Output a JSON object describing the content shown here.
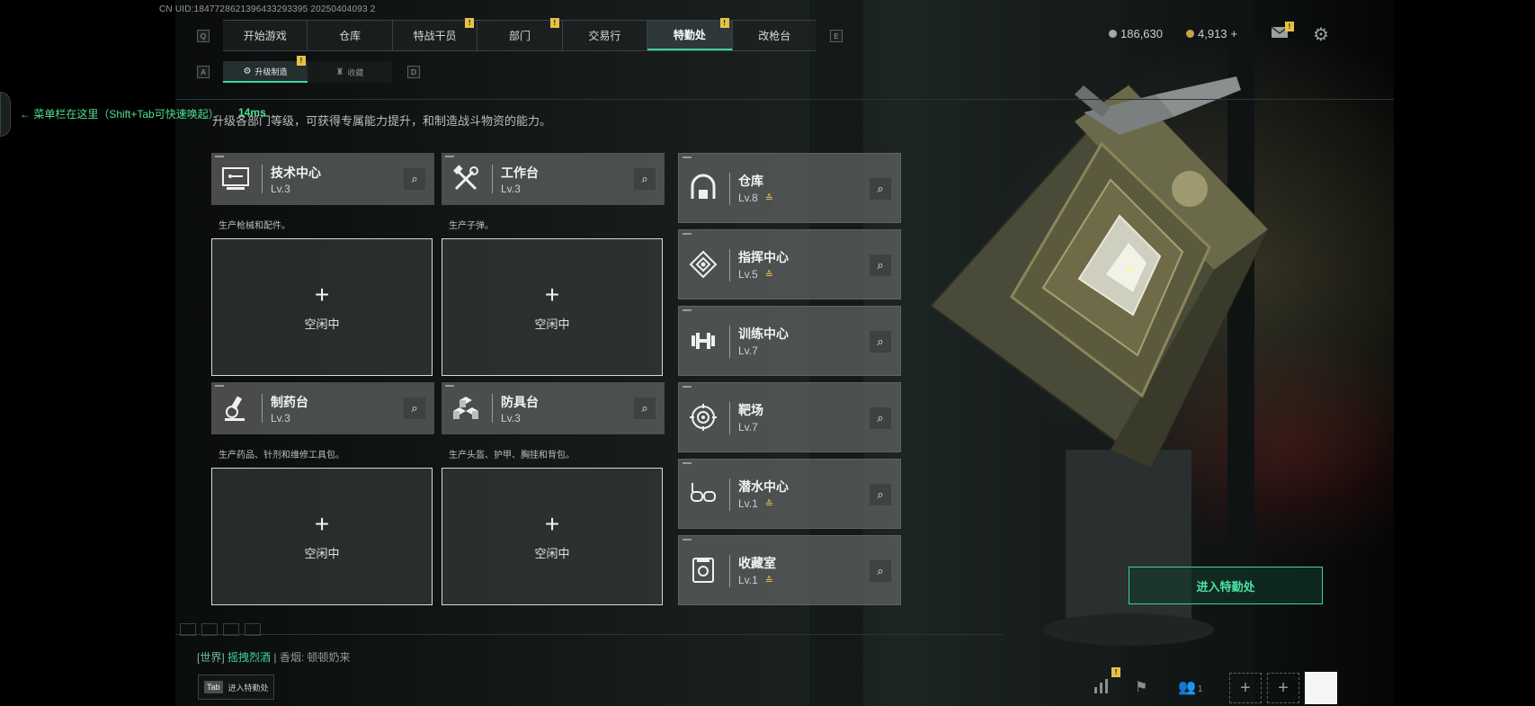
{
  "uid": "CN UID:1847728621396433293395 20250404093 2",
  "top_tabs": [
    {
      "label": "开始游戏",
      "badge": ""
    },
    {
      "label": "仓库",
      "badge": ""
    },
    {
      "label": "特战干员",
      "badge": "!"
    },
    {
      "label": "部门",
      "badge": "!"
    },
    {
      "label": "交易行",
      "badge": ""
    },
    {
      "label": "特勤处",
      "badge": "!",
      "active": true
    },
    {
      "label": "改枪台",
      "badge": ""
    }
  ],
  "key_left": "Q",
  "key_right": "E",
  "sub_tabs": [
    {
      "label": "升级制造",
      "badge": "!",
      "active": true
    },
    {
      "label": "收藏",
      "badge": ""
    }
  ],
  "sub_key_left": "A",
  "sub_key_right": "D",
  "banner": {
    "text": "← 菜单栏在这里（Shift+Tab可快速唤起）",
    "ping": "14ms"
  },
  "description": "升级各部门等级，可获得专属能力提升，和制造战斗物资的能力。",
  "currency": {
    "coins": "186,630",
    "gold": "4,913",
    "gold_plus": "+"
  },
  "mail_badge": "!",
  "production_facilities": [
    {
      "name": "技术中心",
      "level": "Lv.3",
      "note": "生产枪械和配件。",
      "slot": "空闲中",
      "icon": "monitor-icon"
    },
    {
      "name": "工作台",
      "level": "Lv.3",
      "note": "生产子弹。",
      "slot": "空闲中",
      "icon": "tools-icon"
    },
    {
      "name": "制药台",
      "level": "Lv.3",
      "note": "生产药品、针剂和维修工具包。",
      "slot": "空闲中",
      "icon": "microscope-icon"
    },
    {
      "name": "防具台",
      "level": "Lv.3",
      "note": "生产头盔、护甲、胸挂和背包。",
      "slot": "空闲中",
      "icon": "armor-cubes-icon"
    }
  ],
  "side_facilities": [
    {
      "name": "仓库",
      "level": "Lv.8",
      "upgrade": "≙",
      "icon": "warehouse-icon"
    },
    {
      "name": "指挥中心",
      "level": "Lv.5",
      "upgrade": "≙",
      "icon": "command-icon"
    },
    {
      "name": "训练中心",
      "level": "Lv.7",
      "upgrade": "",
      "icon": "dumbbell-icon"
    },
    {
      "name": "靶场",
      "level": "Lv.7",
      "upgrade": "",
      "icon": "target-icon"
    },
    {
      "name": "潜水中心",
      "level": "Lv.1",
      "upgrade": "≙",
      "icon": "diving-mask-icon"
    },
    {
      "name": "收藏室",
      "level": "Lv.1",
      "upgrade": "≙",
      "icon": "collection-icon"
    }
  ],
  "enter_button": "进入特勤处",
  "chat": {
    "channel": "[世界]",
    "sender": "摇拽烈酒",
    "separator": "|",
    "name": "香烟",
    "message": "顿顿奶来"
  },
  "tab_hint": {
    "key": "Tab",
    "label": "进入特勤处"
  },
  "bottom_counts": {
    "friends": "1"
  },
  "bottom_badge": "!"
}
